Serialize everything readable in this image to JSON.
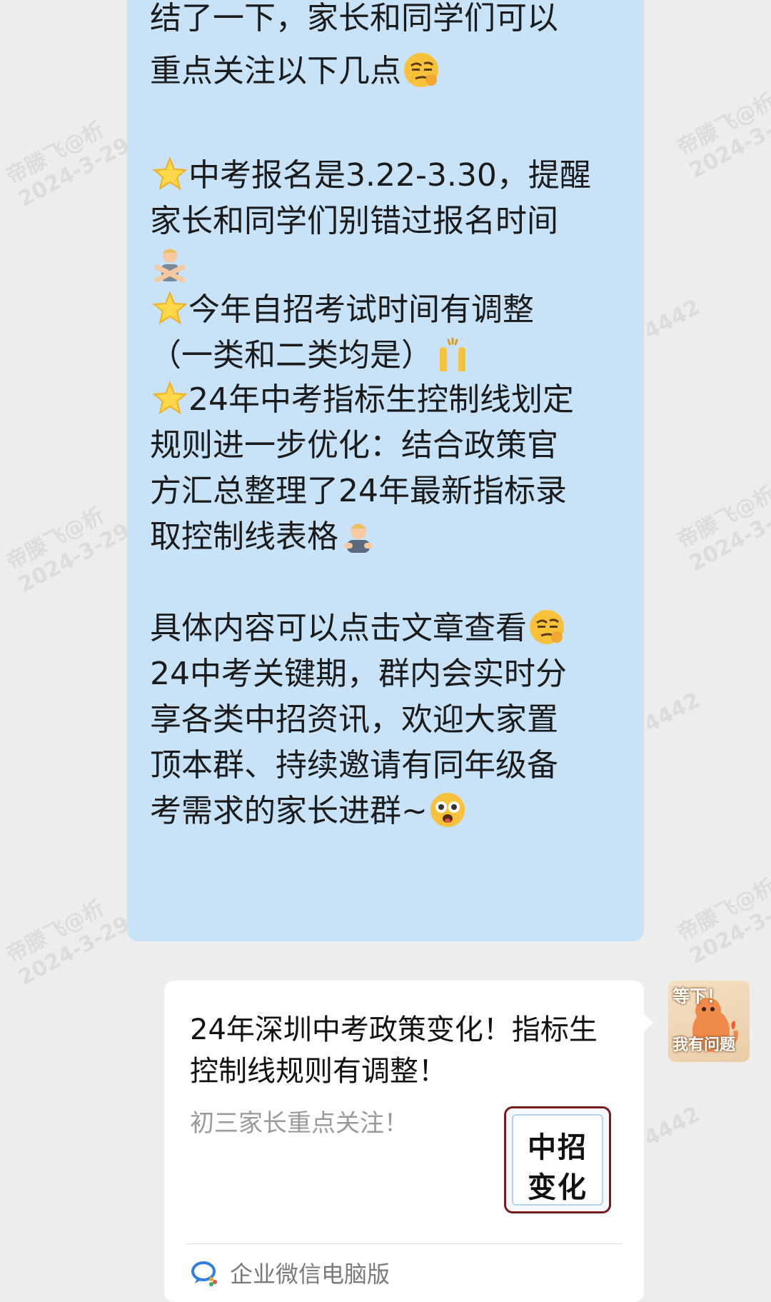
{
  "message": {
    "lines": [
      "结了一下，家长和同学们可以",
      "重点关注以下几点",
      "中考报名是3.22-3.30，提醒",
      "家长和同学们别错过报名时间",
      "今年自招考试时间有调整",
      "（一类和二类均是）",
      "24年中考指标生控制线划定",
      "规则进一步优化：结合政策官",
      "方汇总整理了24年最新指标录",
      "取控制线表格",
      "具体内容可以点击文章查看",
      "24中考关键期，群内会实时分",
      "享各类中招资讯，欢迎大家置",
      "顶本群、持续邀请有同年级备",
      "考需求的家长进群~"
    ],
    "emoji": {
      "thinking": "smirk-emoji",
      "star": "glowing-star-emoji",
      "crossed_arms": "no-gesture-emoji",
      "raised_hands": "raised-hands-emoji",
      "bowing": "bowing-person-emoji",
      "dizzy": "dizzy-face-emoji"
    }
  },
  "link_card": {
    "title": "24年深圳中考政策变化！指标生控制线规则有调整！",
    "description": "初三家长重点关注！",
    "thumbnail": {
      "line1": "中招",
      "line2": "变化"
    },
    "source": "企业微信电脑版"
  },
  "avatar": {
    "top_text": "等下！",
    "bottom_text": "我有问题"
  },
  "watermark": {
    "name": "帝滕飞@析",
    "date": "2024-3-29",
    "partial": "4442"
  },
  "colors": {
    "background": "#ededed",
    "bubble": "#c8e2f7",
    "card": "#ffffff"
  }
}
